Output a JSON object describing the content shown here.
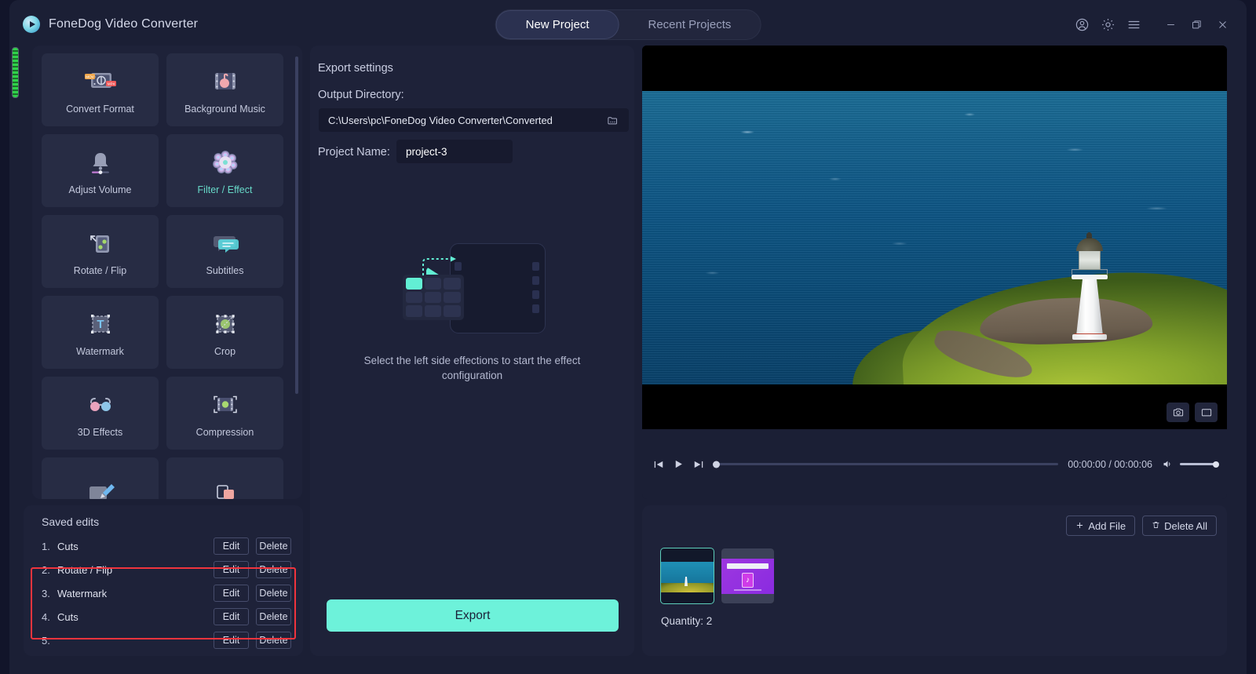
{
  "titlebar": {
    "app_title": "FoneDog Video Converter",
    "logo_icon": "play-circle-logo",
    "tabs": [
      {
        "label": "New Project",
        "active": true
      },
      {
        "label": "Recent Projects",
        "active": false
      }
    ],
    "icons": [
      "account-icon",
      "gear-icon",
      "hamburger-menu-icon",
      "minimize-icon",
      "maximize-icon",
      "close-icon"
    ]
  },
  "tools": {
    "items": [
      {
        "label": "Convert Format",
        "icon": "convert-format-icon",
        "highlighted": false
      },
      {
        "label": "Background Music",
        "icon": "background-music-icon",
        "highlighted": false
      },
      {
        "label": "Adjust Volume",
        "icon": "adjust-volume-icon",
        "highlighted": false
      },
      {
        "label": "Filter / Effect",
        "icon": "filter-effect-icon",
        "highlighted": true
      },
      {
        "label": "Rotate / Flip",
        "icon": "rotate-flip-icon",
        "highlighted": false
      },
      {
        "label": "Subtitles",
        "icon": "subtitles-icon",
        "highlighted": false
      },
      {
        "label": "Watermark",
        "icon": "watermark-icon",
        "highlighted": false
      },
      {
        "label": "Crop",
        "icon": "crop-icon",
        "highlighted": false
      },
      {
        "label": "3D Effects",
        "icon": "3d-effects-icon",
        "highlighted": false
      },
      {
        "label": "Compression",
        "icon": "compression-icon",
        "highlighted": false
      }
    ]
  },
  "saved_edits": {
    "title": "Saved edits",
    "edit_label": "Edit",
    "delete_label": "Delete",
    "rows": [
      {
        "num": "1.",
        "name": "Cuts"
      },
      {
        "num": "2.",
        "name": "Rotate / Flip"
      },
      {
        "num": "3.",
        "name": "Watermark"
      },
      {
        "num": "4.",
        "name": "Cuts"
      },
      {
        "num": "5.",
        "name": ""
      }
    ],
    "highlight_color": "#f0343d"
  },
  "export_settings": {
    "heading": "Export settings",
    "output_dir_label": "Output Directory:",
    "output_dir_value": "C:\\Users\\pc\\FoneDog Video Converter\\Converted",
    "folder_icon": "folder-icon",
    "project_name_label": "Project Name:",
    "project_name_value": "project-3",
    "placeholder_text": "Select the left side effections to start the effect configuration",
    "placeholder_icon": "effects-placeholder-icon",
    "export_button": "Export",
    "accent_color": "#6df2da"
  },
  "preview": {
    "scene": "lighthouse-on-headland-above-ocean",
    "controls": {
      "prev_icon": "previous-icon",
      "play_icon": "play-icon",
      "next_icon": "next-icon",
      "time": "00:00:00 / 00:00:06",
      "volume_icon": "volume-icon"
    },
    "overlay_buttons": [
      "snapshot-camera-icon",
      "fullscreen-icon"
    ]
  },
  "files": {
    "add_file_label": "Add File",
    "delete_all_label": "Delete All",
    "add_icon": "plus-icon",
    "delete_icon": "trash-icon",
    "quantity": "Quantity: 2",
    "thumbnails": [
      {
        "name": "lighthouse-video-thumbnail",
        "selected": true
      },
      {
        "name": "music-video-thumbnail",
        "selected": false
      }
    ]
  }
}
